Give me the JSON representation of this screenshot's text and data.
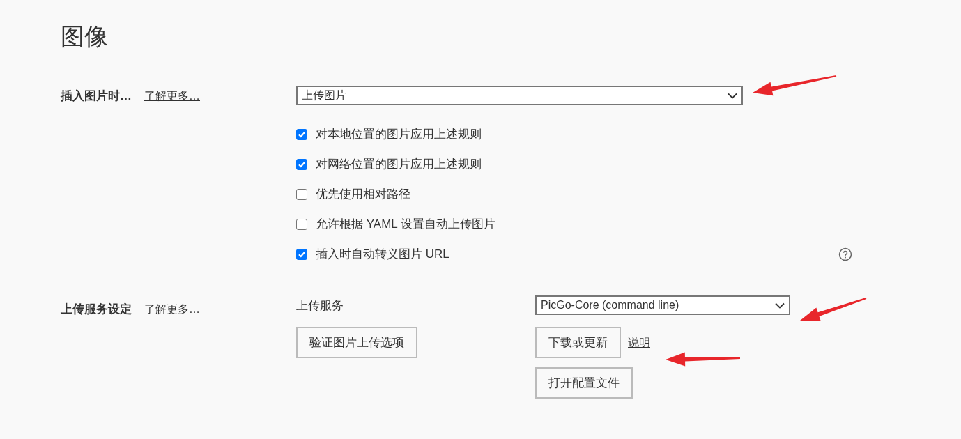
{
  "page_title": "图像",
  "insert_image": {
    "label": "插入图片时…",
    "link": "了解更多…",
    "select": {
      "value": "上传图片"
    },
    "options": [
      {
        "label": "对本地位置的图片应用上述规则",
        "checked": true,
        "help": false
      },
      {
        "label": "对网络位置的图片应用上述规则",
        "checked": true,
        "help": false
      },
      {
        "label": "优先使用相对路径",
        "checked": false,
        "help": false
      },
      {
        "label": "允许根据 YAML 设置自动上传图片",
        "checked": false,
        "help": false
      },
      {
        "label": "插入时自动转义图片 URL",
        "checked": true,
        "help": true
      }
    ]
  },
  "upload_service": {
    "label": "上传服务设定",
    "link": "了解更多…",
    "service_label": "上传服务",
    "verify_button": "验证图片上传选项",
    "select": {
      "value": "PicGo-Core (command line)"
    },
    "buttons": [
      {
        "label": "下载或更新",
        "link": "说明"
      },
      {
        "label": "打开配置文件"
      }
    ]
  }
}
